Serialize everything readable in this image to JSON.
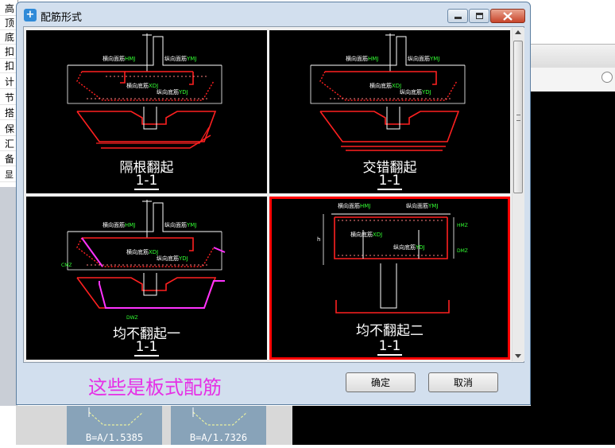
{
  "background": {
    "left_column": [
      "高",
      "顶",
      "底",
      "扣",
      "扣",
      "计",
      "节",
      "搭",
      "保",
      "汇",
      "备"
    ],
    "left_bottom": "显",
    "thumb1_label": "B=A/1.5385",
    "thumb2_label": "B=A/1.7326"
  },
  "dialog": {
    "title": "配筋形式",
    "options": [
      {
        "title": "隔根翻起",
        "section": "1-1",
        "selected": false
      },
      {
        "title": "交错翻起",
        "section": "1-1",
        "selected": false
      },
      {
        "title": "均不翻起一",
        "section": "1-1",
        "selected": false
      },
      {
        "title": "均不翻起二",
        "section": "1-1",
        "selected": true
      }
    ],
    "drawing_labels": {
      "top_transverse": "横向面筋",
      "top_transverse_code": "HMJ",
      "top_longitudinal": "纵向面筋",
      "top_longitudinal_code": "YMJ",
      "bottom_transverse": "横向底筋",
      "bottom_transverse_code": "XDJ",
      "bottom_longitudinal": "纵向底筋",
      "bottom_longitudinal_code": "YDJ",
      "dimension_h": "h",
      "code_hmz": "HMZ",
      "code_dmz": "DMZ",
      "code_dwz": "DWZ",
      "code_cmz": "CMZ"
    },
    "note": "这些是板式配筋",
    "ok_label": "确定",
    "cancel_label": "取消"
  },
  "colors": {
    "rebar": "#ff2020",
    "magenta": "#ff33ff",
    "label_green": "#33ff33",
    "selected_border": "#ff0000",
    "note": "#e630e6"
  }
}
